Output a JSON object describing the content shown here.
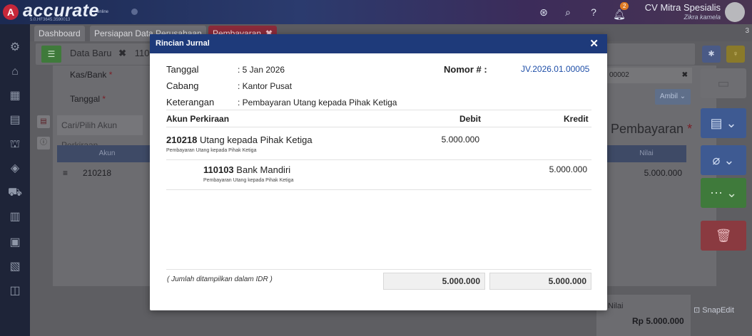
{
  "app": {
    "logo_text": "accurate",
    "logo_sub": "online",
    "version": "5.0.HF3645.3590013",
    "company": "CV Mitra Spesialis",
    "user": "Zikra kamela",
    "notification_count": "2"
  },
  "tabs": [
    {
      "label": "Dashboard"
    },
    {
      "label": "Persiapan Data Perusahaan"
    },
    {
      "label": "Pembayaran",
      "close": "✖"
    }
  ],
  "tab_count": "3",
  "subtab": {
    "label": "Data Baru",
    "close": "✖",
    "extra": "110"
  },
  "form": {
    "kas_bank_label": "Kas/Bank",
    "tanggal_label": "Tanggal",
    "required": "*",
    "search_placeholder": "Cari/Pilih Akun Perkiraan",
    "grid_col_akun": "Akun",
    "grid_row_akun": "210218",
    "right_field_value": "00002",
    "right_field_clear": "✖",
    "ambil_label": "Ambil",
    "pembayaran_title": "Pembayaran",
    "grid_col_nilai": "Nilai",
    "grid_row_nilai": "5.000.000",
    "summary_label": "Nilai",
    "summary_value": "Rp 5.000.000"
  },
  "watermark": "SnapEdit",
  "modal": {
    "title": "Rincian Jurnal",
    "close": "✕",
    "tanggal_label": "Tanggal",
    "tanggal_value": ": 5 Jan 2026",
    "cabang_label": "Cabang",
    "cabang_value": ": Kantor Pusat",
    "keterangan_label": "Keterangan",
    "keterangan_value": ": Pembayaran Utang kepada Pihak Ketiga",
    "nomor_label": "Nomor # :",
    "nomor_value": "JV.2026.01.00005",
    "col_akun": "Akun Perkiraan",
    "col_debit": "Debit",
    "col_kredit": "Kredit",
    "entries": [
      {
        "code": "210218",
        "name": "Utang kepada Pihak Ketiga",
        "desc": "Pembayaran Utang kepada Pihak Ketiga",
        "debit": "5.000.000",
        "kredit": ""
      },
      {
        "code": "110103",
        "name": "Bank Mandiri",
        "desc": "Pembayaran Utang kepada Pihak Ketiga",
        "debit": "",
        "kredit": "5.000.000"
      }
    ],
    "footer_note": "( Jumlah ditampilkan dalam IDR )",
    "total_debit": "5.000.000",
    "total_kredit": "5.000.000"
  }
}
